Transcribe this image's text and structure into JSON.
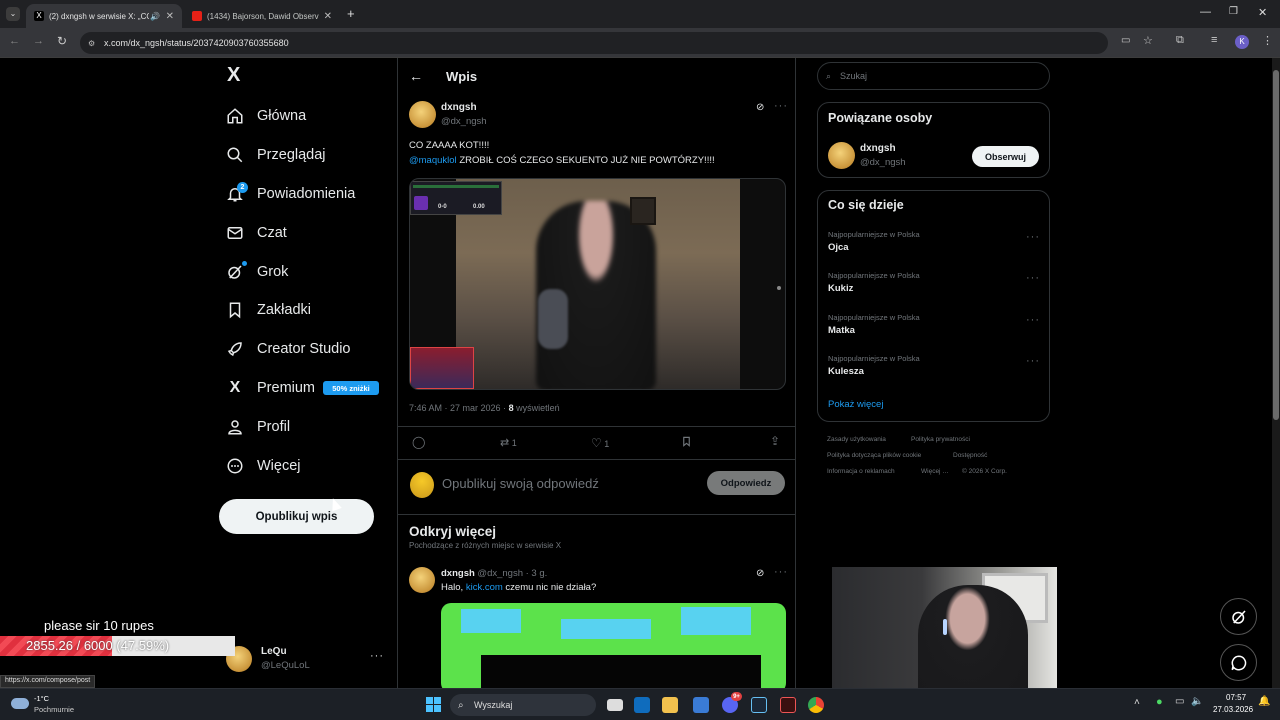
{
  "browser": {
    "tabs": [
      {
        "title": "(2) dxngsh w serwisie X: „CO",
        "active": true
      },
      {
        "title": "(1434) Bajorson, Dawid Observ",
        "active": false
      }
    ],
    "new_tab": "+",
    "url": "x.com/dx_ngsh/status/2037420903760355680",
    "status_url": "https://x.com/compose/post"
  },
  "nav": {
    "logo": "X",
    "items": [
      {
        "label": "Główna",
        "icon": "home-icon"
      },
      {
        "label": "Przeglądaj",
        "icon": "search-icon"
      },
      {
        "label": "Powiadomienia",
        "icon": "bell-icon",
        "badge": "2"
      },
      {
        "label": "Czat",
        "icon": "mail-icon"
      },
      {
        "label": "Grok",
        "icon": "grok-icon"
      },
      {
        "label": "Zakładki",
        "icon": "bookmark-icon"
      },
      {
        "label": "Creator Studio",
        "icon": "rocket-icon"
      },
      {
        "label": "Premium",
        "icon": "x-logo-icon",
        "badge": "50% zniżki"
      },
      {
        "label": "Profil",
        "icon": "person-icon"
      },
      {
        "label": "Więcej",
        "icon": "more-circle-icon"
      }
    ],
    "post_button": "Opublikuj wpis",
    "account": {
      "name": "LeQu",
      "handle": "@LeQuLoL"
    }
  },
  "post": {
    "header_title": "Wpis",
    "author": "dxngsh",
    "handle": "@dx_ngsh",
    "text_line1": "CO ZAAAA KOT!!!!",
    "mention": "@maquklol",
    "text_line2": "ZROBIŁ COŚ CZEGO SEKUENTO JUŻ NIE POWTÓRZY!!!!",
    "video_overlay": {
      "score1": "0-0",
      "score2": "0.00"
    },
    "timestamp": "7:46 AM · 27 mar 2026 ·",
    "views_count": "8",
    "views_label": "wyświetleń",
    "actions": {
      "reply": "",
      "repost": "1",
      "like": "1"
    },
    "reply_placeholder": "Opublikuj swoją odpowiedź",
    "reply_button": "Odpowiedz"
  },
  "discover": {
    "title": "Odkryj więcej",
    "subtitle": "Pochodzące z różnych miejsc w serwisie X",
    "post": {
      "author": "dxngsh",
      "meta": "@dx_ngsh · 3 g.",
      "text_prefix": "Halo,",
      "link": "kick.com",
      "text_suffix": "czemu nic nie działa?"
    }
  },
  "sidebar": {
    "search_placeholder": "Szukaj",
    "related_title": "Powiązane osoby",
    "related_user": {
      "name": "dxngsh",
      "handle": "@dx_ngsh",
      "button": "Obserwuj"
    },
    "trends_title": "Co się dzieje",
    "trends": [
      {
        "category": "Najpopularniejsze w Polska",
        "name": "Ojca"
      },
      {
        "category": "Najpopularniejsze w Polska",
        "name": "Kukiz"
      },
      {
        "category": "Najpopularniejsze w Polska",
        "name": "Matka"
      },
      {
        "category": "Najpopularniejsze w Polska",
        "name": "Kulesza"
      }
    ],
    "show_more": "Pokaż więcej",
    "footer": [
      "Zasady użytkowania",
      "Polityka prywatności",
      "Polityka dotycząca plików cookie",
      "Dostępność",
      "Informacja o reklamach",
      "Więcej …",
      "© 2026 X Corp."
    ]
  },
  "overlay": {
    "donation_text": "please sir 10 rupes",
    "donation_progress_text": "2855.26 / 6000 (47.59%)",
    "donation_progress": 0.4759
  },
  "taskbar": {
    "weather_temp": "-1°C",
    "weather_desc": "Pochmurnie",
    "search": "Wyszukaj",
    "time": "07:57",
    "date": "27.03.2026",
    "discord_badge": "9+"
  },
  "colors": {
    "accent": "#1d9bf0",
    "background": "#000000",
    "border": "#2f3336"
  }
}
